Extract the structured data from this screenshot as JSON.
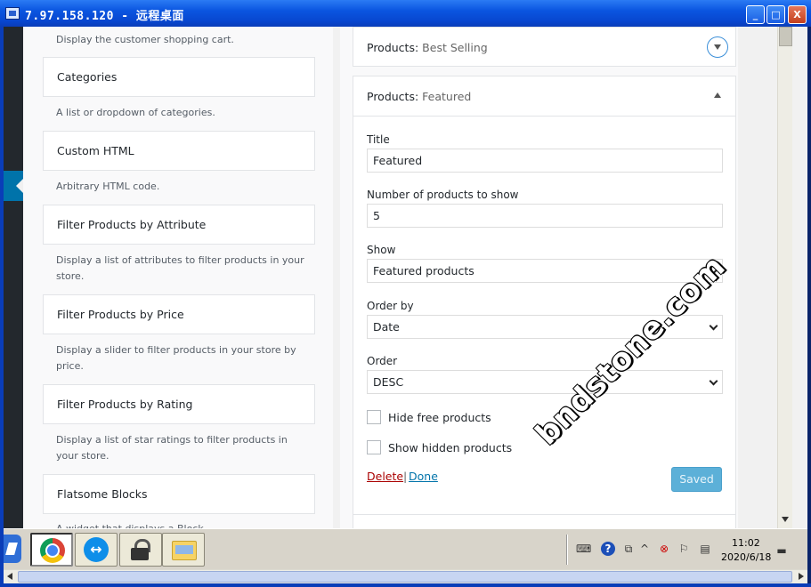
{
  "window": {
    "title": "7.97.158.120 - 远程桌面",
    "min_glyph": "_",
    "max_glyph": "□",
    "close_glyph": "X"
  },
  "left_widgets": {
    "cart_desc": "Display the customer shopping cart.",
    "items": [
      {
        "title": "Categories",
        "desc": "A list or dropdown of categories."
      },
      {
        "title": "Custom HTML",
        "desc": "Arbitrary HTML code."
      },
      {
        "title": "Filter Products by Attribute",
        "desc": "Display a list of attributes to filter products in your store."
      },
      {
        "title": "Filter Products by Price",
        "desc": "Display a slider to filter products in your store by price."
      },
      {
        "title": "Filter Products by Rating",
        "desc": "Display a list of star ratings to filter products in your store."
      },
      {
        "title": "Flatsome Blocks",
        "desc": "A widget that displays a Block"
      }
    ]
  },
  "panels": {
    "best_selling": {
      "prefix": "Products:",
      "name": "Best Selling"
    },
    "featured": {
      "prefix": "Products:",
      "name": "Featured"
    }
  },
  "form": {
    "title_label": "Title",
    "title_value": "Featured",
    "number_label": "Number of products to show",
    "number_value": "5",
    "show_label": "Show",
    "show_value": "Featured products",
    "orderby_label": "Order by",
    "orderby_value": "Date",
    "order_label": "Order",
    "order_value": "DESC",
    "hide_free_label": "Hide free products",
    "show_hidden_label": "Show hidden products",
    "delete_label": "Delete",
    "separator": "|",
    "done_label": "Done",
    "saved_label": "Saved"
  },
  "watermark": "bndstone.com",
  "taskbar": {
    "clock_time": "11:02",
    "clock_date": "2020/6/18"
  }
}
